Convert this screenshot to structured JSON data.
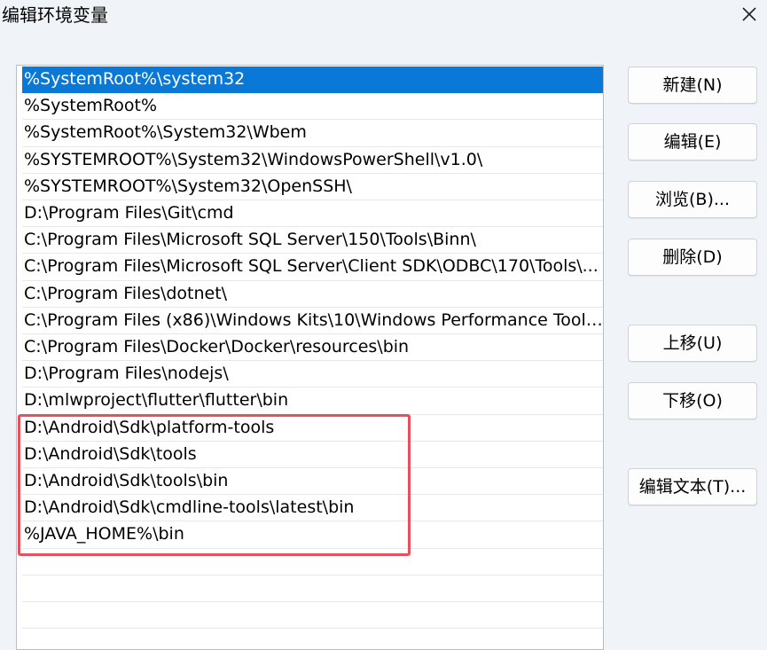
{
  "dialog": {
    "title": "编辑环境变量"
  },
  "path_list": {
    "selected_index": 0,
    "items": [
      "%SystemRoot%\\system32",
      "%SystemRoot%",
      "%SystemRoot%\\System32\\Wbem",
      "%SYSTEMROOT%\\System32\\WindowsPowerShell\\v1.0\\",
      "%SYSTEMROOT%\\System32\\OpenSSH\\",
      "D:\\Program Files\\Git\\cmd",
      "C:\\Program Files\\Microsoft SQL Server\\150\\Tools\\Binn\\",
      "C:\\Program Files\\Microsoft SQL Server\\Client SDK\\ODBC\\170\\Tools\\...",
      "C:\\Program Files\\dotnet\\",
      "C:\\Program Files (x86)\\Windows Kits\\10\\Windows Performance Toolk...",
      "C:\\Program Files\\Docker\\Docker\\resources\\bin",
      "D:\\Program Files\\nodejs\\",
      "D:\\mlwproject\\flutter\\flutter\\bin",
      "D:\\Android\\Sdk\\platform-tools",
      "D:\\Android\\Sdk\\tools",
      "D:\\Android\\Sdk\\tools\\bin",
      "D:\\Android\\Sdk\\cmdline-tools\\latest\\bin",
      "%JAVA_HOME%\\bin",
      "",
      "",
      ""
    ]
  },
  "buttons": {
    "new": "新建(N)",
    "edit": "编辑(E)",
    "browse": "浏览(B)...",
    "delete": "删除(D)",
    "move_up": "上移(U)",
    "move_down": "下移(O)",
    "edit_text": "编辑文本(T)..."
  },
  "colors": {
    "selection": "#0a78d7",
    "highlight_box": "#e8505b"
  },
  "icons": {
    "close": "close-icon"
  }
}
